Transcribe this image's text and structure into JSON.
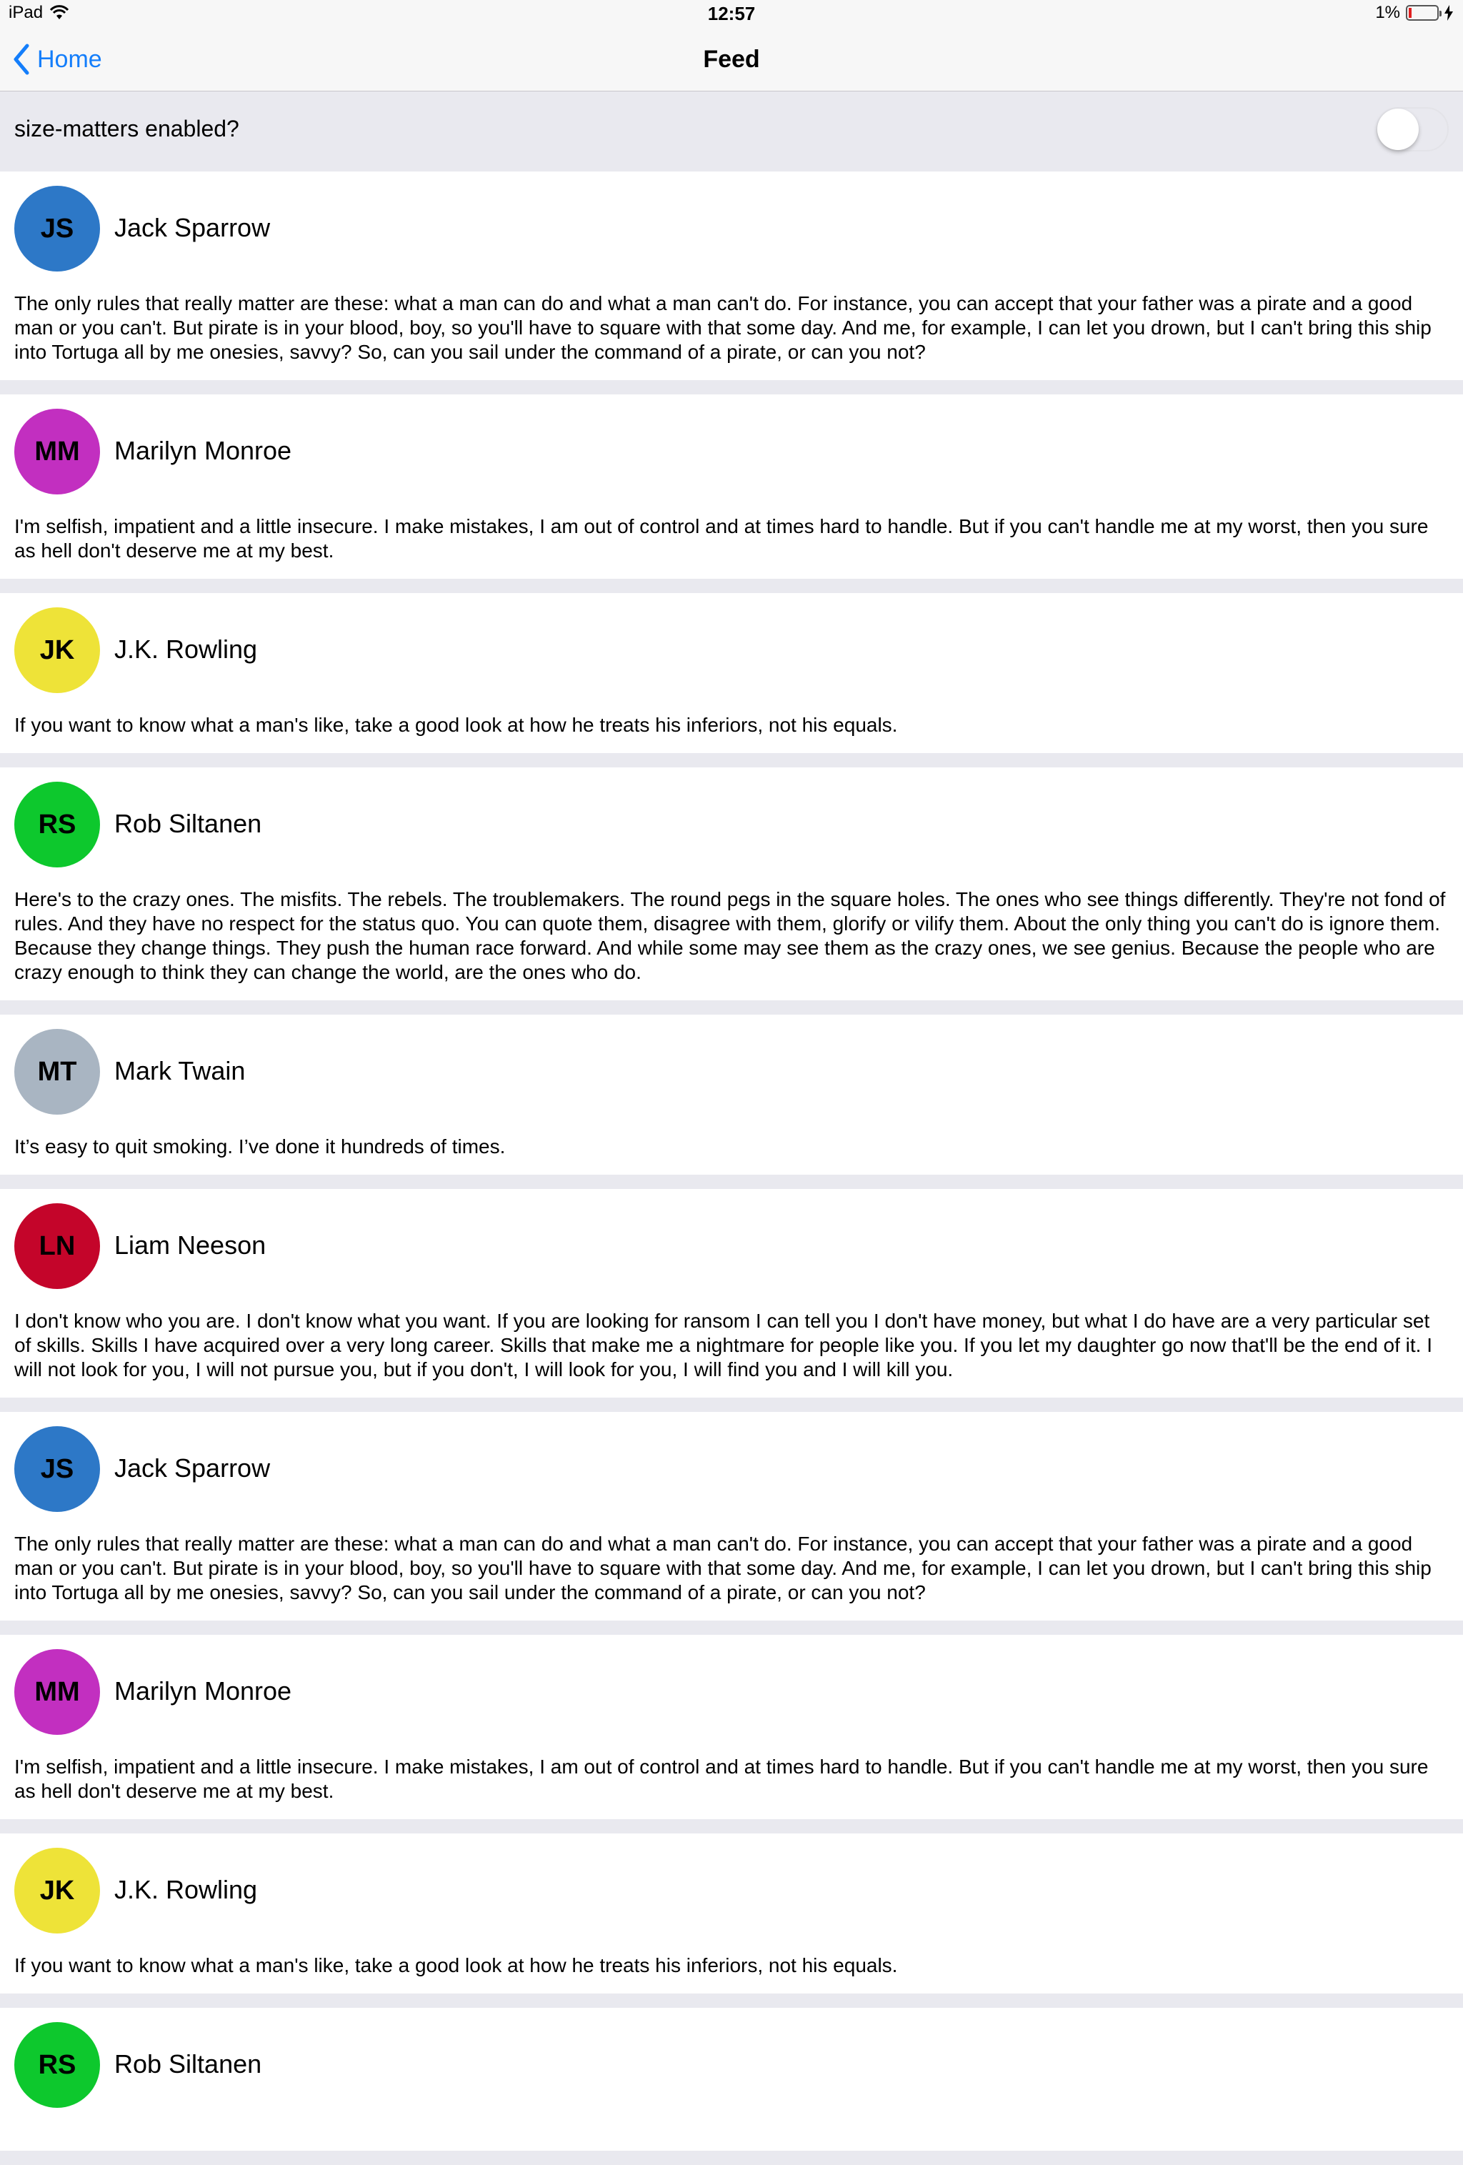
{
  "status_bar": {
    "device": "iPad",
    "time": "12:57",
    "battery": "1%"
  },
  "nav": {
    "back_label": "Home",
    "title": "Feed"
  },
  "settings": {
    "toggle_label": "size-matters enabled?",
    "toggle_on": false
  },
  "feed": [
    {
      "initials": "JS",
      "name": "Jack Sparrow",
      "color": "#2d78c7",
      "quote": "The only rules that really matter are these: what a man can do and what a man can't do. For instance, you can accept that your father was a pirate and a good man or you can't. But pirate is in your blood, boy, so you'll have to square with that some day. And me, for example, I can let you drown, but I can't bring this ship into Tortuga all by me onesies, savvy? So, can you sail under the command of a pirate, or can you not?"
    },
    {
      "initials": "MM",
      "name": "Marilyn Monroe",
      "color": "#c22fc0",
      "quote": "I'm selfish, impatient and a little insecure. I make mistakes, I am out of control and at times hard to handle. But if you can't handle me at my worst, then you sure as hell don't deserve me at my best."
    },
    {
      "initials": "JK",
      "name": "J.K. Rowling",
      "color": "#eee338",
      "quote": "If you want to know what a man's like, take a good look at how he treats his inferiors, not his equals."
    },
    {
      "initials": "RS",
      "name": "Rob Siltanen",
      "color": "#0dc82d",
      "quote": "Here's to the crazy ones. The misfits. The rebels. The troublemakers. The round pegs in the square holes. The ones who see things differently. They're not fond of rules. And they have no respect for the status quo. You can quote them, disagree with them, glorify or vilify them. About the only thing you can't do is ignore them. Because they change things. They push the human race forward. And while some may see them as the crazy ones, we see genius. Because the people who are crazy enough to think they can change the world, are the ones who do."
    },
    {
      "initials": "MT",
      "name": "Mark Twain",
      "color": "#a9b5c2",
      "quote": "It’s easy to quit smoking. I’ve done it hundreds of times."
    },
    {
      "initials": "LN",
      "name": "Liam Neeson",
      "color": "#c4052a",
      "quote": "I don't know who you are. I don't know what you want. If you are looking for ransom I can tell you I don't have money, but what I do have are a very particular set of skills. Skills I have acquired over a very long career. Skills that make me a nightmare for people like you. If you let my daughter go now that'll be the end of it. I will not look for you, I will not pursue you, but if you don't, I will look for you, I will find you and I will kill you."
    },
    {
      "initials": "JS",
      "name": "Jack Sparrow",
      "color": "#2d78c7",
      "quote": "The only rules that really matter are these: what a man can do and what a man can't do. For instance, you can accept that your father was a pirate and a good man or you can't. But pirate is in your blood, boy, so you'll have to square with that some day. And me, for example, I can let you drown, but I can't bring this ship into Tortuga all by me onesies, savvy? So, can you sail under the command of a pirate, or can you not?"
    },
    {
      "initials": "MM",
      "name": "Marilyn Monroe",
      "color": "#c22fc0",
      "quote": "I'm selfish, impatient and a little insecure. I make mistakes, I am out of control and at times hard to handle. But if you can't handle me at my worst, then you sure as hell don't deserve me at my best."
    },
    {
      "initials": "JK",
      "name": "J.K. Rowling",
      "color": "#eee338",
      "quote": "If you want to know what a man's like, take a good look at how he treats his inferiors, not his equals."
    },
    {
      "initials": "RS",
      "name": "Rob Siltanen",
      "color": "#0dc82d",
      "quote": ""
    }
  ]
}
